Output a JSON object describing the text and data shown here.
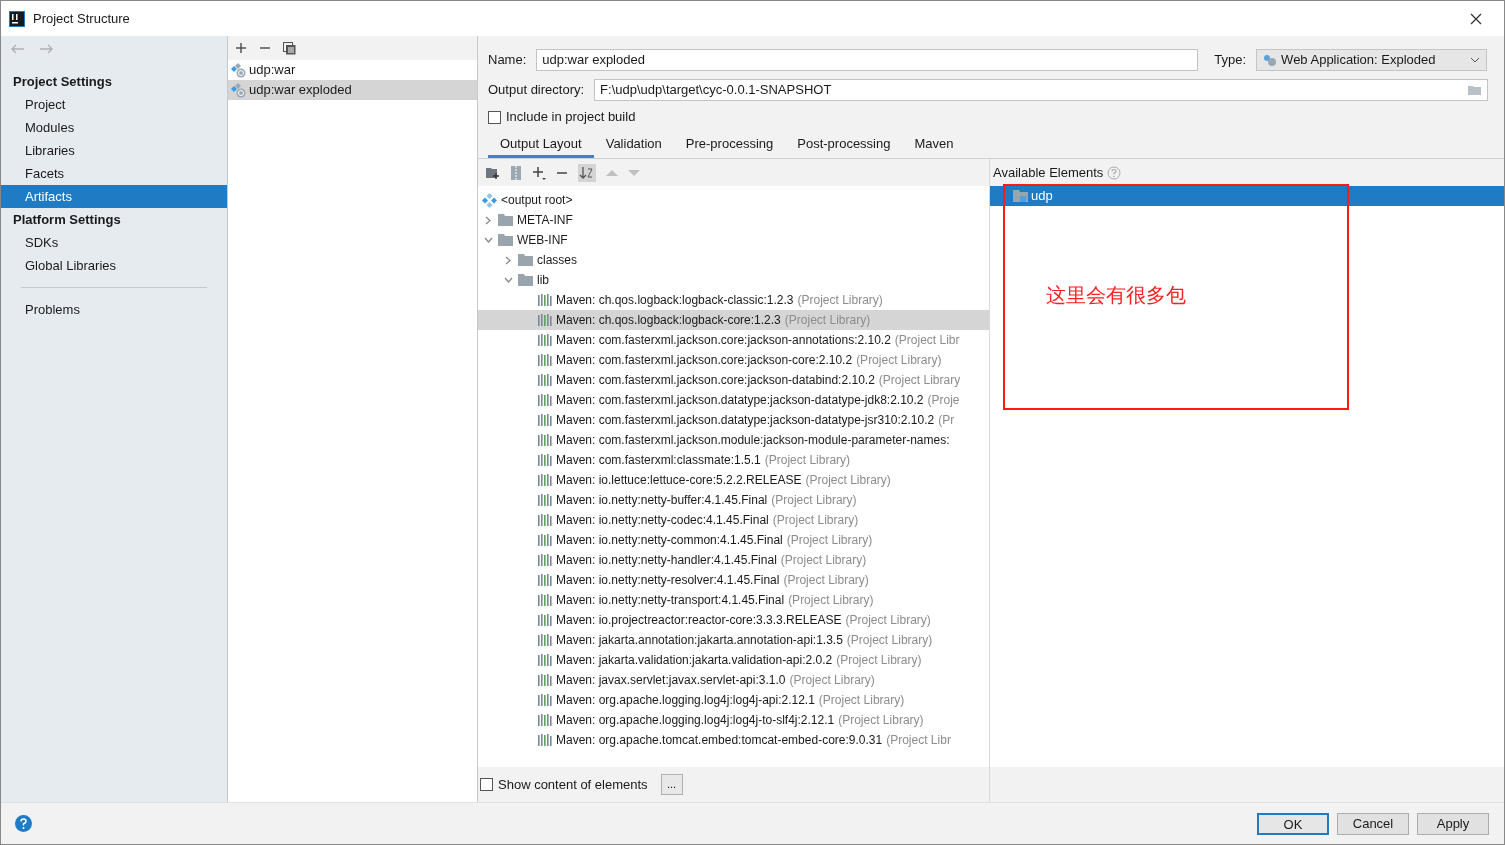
{
  "window": {
    "title": "Project Structure"
  },
  "sidebar": {
    "sections": [
      {
        "title": "Project Settings",
        "items": [
          {
            "label": "Project",
            "selected": false
          },
          {
            "label": "Modules",
            "selected": false
          },
          {
            "label": "Libraries",
            "selected": false
          },
          {
            "label": "Facets",
            "selected": false
          },
          {
            "label": "Artifacts",
            "selected": true
          }
        ]
      },
      {
        "title": "Platform Settings",
        "items": [
          {
            "label": "SDKs",
            "selected": false
          },
          {
            "label": "Global Libraries",
            "selected": false
          }
        ]
      }
    ],
    "problems": "Problems"
  },
  "artifacts": [
    {
      "label": "udp:war",
      "selected": false
    },
    {
      "label": "udp:war exploded",
      "selected": true
    }
  ],
  "form": {
    "name_label": "Name:",
    "name_value": "udp:war exploded",
    "type_label": "Type:",
    "type_value": "Web Application: Exploded",
    "output_label": "Output directory:",
    "output_value": "F:\\udp\\udp\\target\\cyc-0.0.1-SNAPSHOT",
    "include_label": "Include in project build",
    "include_checked": false
  },
  "tabs": [
    {
      "label": "Output Layout",
      "selected": true
    },
    {
      "label": "Validation",
      "selected": false
    },
    {
      "label": "Pre-processing",
      "selected": false
    },
    {
      "label": "Post-processing",
      "selected": false
    },
    {
      "label": "Maven",
      "selected": false
    }
  ],
  "tree": [
    {
      "kind": "root",
      "label": "<output root>",
      "children": [
        {
          "kind": "folder",
          "label": "META-INF",
          "expanded": false
        },
        {
          "kind": "folder",
          "label": "WEB-INF",
          "expanded": true,
          "children": [
            {
              "kind": "folder",
              "label": "classes",
              "expanded": false
            },
            {
              "kind": "folder",
              "label": "lib",
              "expanded": true,
              "children": [
                {
                  "kind": "library",
                  "label": "Maven: ch.qos.logback:logback-classic:1.2.3",
                  "suffix": "(Project Library)",
                  "selected": false
                },
                {
                  "kind": "library",
                  "label": "Maven: ch.qos.logback:logback-core:1.2.3",
                  "suffix": "(Project Library)",
                  "selected": true
                },
                {
                  "kind": "library",
                  "label": "Maven: com.fasterxml.jackson.core:jackson-annotations:2.10.2",
                  "suffix": "(Project Libr",
                  "selected": false
                },
                {
                  "kind": "library",
                  "label": "Maven: com.fasterxml.jackson.core:jackson-core:2.10.2",
                  "suffix": "(Project Library)",
                  "selected": false
                },
                {
                  "kind": "library",
                  "label": "Maven: com.fasterxml.jackson.core:jackson-databind:2.10.2",
                  "suffix": "(Project Library",
                  "selected": false
                },
                {
                  "kind": "library",
                  "label": "Maven: com.fasterxml.jackson.datatype:jackson-datatype-jdk8:2.10.2",
                  "suffix": "(Proje",
                  "selected": false
                },
                {
                  "kind": "library",
                  "label": "Maven: com.fasterxml.jackson.datatype:jackson-datatype-jsr310:2.10.2",
                  "suffix": "(Pr",
                  "selected": false
                },
                {
                  "kind": "library",
                  "label": "Maven: com.fasterxml.jackson.module:jackson-module-parameter-names:",
                  "selected": false
                },
                {
                  "kind": "library",
                  "label": "Maven: com.fasterxml:classmate:1.5.1",
                  "suffix": "(Project Library)",
                  "selected": false
                },
                {
                  "kind": "library",
                  "label": "Maven: io.lettuce:lettuce-core:5.2.2.RELEASE",
                  "suffix": "(Project Library)",
                  "selected": false
                },
                {
                  "kind": "library",
                  "label": "Maven: io.netty:netty-buffer:4.1.45.Final",
                  "suffix": "(Project Library)",
                  "selected": false
                },
                {
                  "kind": "library",
                  "label": "Maven: io.netty:netty-codec:4.1.45.Final",
                  "suffix": "(Project Library)",
                  "selected": false
                },
                {
                  "kind": "library",
                  "label": "Maven: io.netty:netty-common:4.1.45.Final",
                  "suffix": "(Project Library)",
                  "selected": false
                },
                {
                  "kind": "library",
                  "label": "Maven: io.netty:netty-handler:4.1.45.Final",
                  "suffix": "(Project Library)",
                  "selected": false
                },
                {
                  "kind": "library",
                  "label": "Maven: io.netty:netty-resolver:4.1.45.Final",
                  "suffix": "(Project Library)",
                  "selected": false
                },
                {
                  "kind": "library",
                  "label": "Maven: io.netty:netty-transport:4.1.45.Final",
                  "suffix": "(Project Library)",
                  "selected": false
                },
                {
                  "kind": "library",
                  "label": "Maven: io.projectreactor:reactor-core:3.3.3.RELEASE",
                  "suffix": "(Project Library)",
                  "selected": false
                },
                {
                  "kind": "library",
                  "label": "Maven: jakarta.annotation:jakarta.annotation-api:1.3.5",
                  "suffix": "(Project Library)",
                  "selected": false
                },
                {
                  "kind": "library",
                  "label": "Maven: jakarta.validation:jakarta.validation-api:2.0.2",
                  "suffix": "(Project Library)",
                  "selected": false
                },
                {
                  "kind": "library",
                  "label": "Maven: javax.servlet:javax.servlet-api:3.1.0",
                  "suffix": "(Project Library)",
                  "selected": false
                },
                {
                  "kind": "library",
                  "label": "Maven: org.apache.logging.log4j:log4j-api:2.12.1",
                  "suffix": "(Project Library)",
                  "selected": false
                },
                {
                  "kind": "library",
                  "label": "Maven: org.apache.logging.log4j:log4j-to-slf4j:2.12.1",
                  "suffix": "(Project Library)",
                  "selected": false
                },
                {
                  "kind": "library",
                  "label": "Maven: org.apache.tomcat.embed:tomcat-embed-core:9.0.31",
                  "suffix": "(Project Libr",
                  "selected": false
                }
              ]
            }
          ]
        }
      ]
    }
  ],
  "available": {
    "title": "Available Elements",
    "items": [
      {
        "label": "udp",
        "selected": true
      }
    ]
  },
  "annotation": "这里会有很多包",
  "show_content": {
    "label": "Show content of elements",
    "checked": false,
    "more": "..."
  },
  "buttons": [
    {
      "label": "OK",
      "default": true
    },
    {
      "label": "Cancel",
      "default": false
    },
    {
      "label": "Apply",
      "default": false
    }
  ]
}
